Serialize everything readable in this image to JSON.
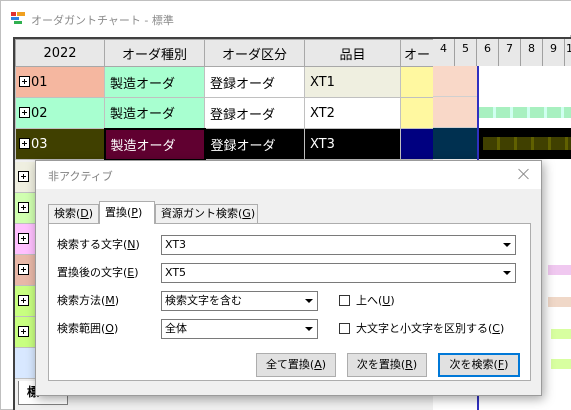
{
  "window": {
    "title": "オーダガントチャート - 標準"
  },
  "grid": {
    "headers": [
      "2022",
      "オーダ種別",
      "オーダ区分",
      "品目",
      "オー"
    ],
    "rows": [
      {
        "id": "01",
        "type": "製造オーダ",
        "category": "登録オーダ",
        "item": "XT1"
      },
      {
        "id": "02",
        "type": "製造オーダ",
        "category": "登録オーダ",
        "item": "XT2"
      },
      {
        "id": "03",
        "type": "製造オーダ",
        "category": "登録オーダ",
        "item": "XT3"
      }
    ],
    "row_colors": [
      "#f5b7a0",
      "#a8ffd0",
      "#8080ff",
      "#d0ffb0",
      "#ffc0ff",
      "#e8b8a8",
      "#c8ff80",
      "#c8ff80"
    ],
    "selected_row_color": "#600030"
  },
  "gantt": {
    "day_headers": [
      "4",
      "5",
      "6",
      "7",
      "8",
      "9",
      "1"
    ]
  },
  "dialog": {
    "title": "非アクティブ",
    "tabs": [
      {
        "label": "検索(",
        "key": "D",
        "end": ")"
      },
      {
        "label": "置換(",
        "key": "P",
        "end": ")"
      },
      {
        "label": "資源ガント検索(",
        "key": "G",
        "end": ")"
      }
    ],
    "search_label": {
      "pre": "検索する文字(",
      "key": "N",
      "end": ")"
    },
    "search_value": "XT3",
    "replace_label": {
      "pre": "置換後の文字(",
      "key": "E",
      "end": ")"
    },
    "replace_value": "XT5",
    "method_label": {
      "pre": "検索方法(",
      "key": "M",
      "end": ")"
    },
    "method_value": "検索文字を含む",
    "range_label": {
      "pre": "検索範囲(",
      "key": "O",
      "end": ")"
    },
    "range_value": "全体",
    "up_label": {
      "pre": "上へ(",
      "key": "U",
      "end": ")"
    },
    "case_label": {
      "pre": "大文字と小文字を区別する(",
      "key": "C",
      "end": ")"
    },
    "buttons": {
      "replace_all": {
        "pre": "全て置換(",
        "key": "A",
        "end": ")"
      },
      "replace_next": {
        "pre": "次を置換(",
        "key": "R",
        "end": ")"
      },
      "find_next": {
        "pre": "次を検索(",
        "key": "F",
        "end": ")"
      }
    }
  },
  "sheet_tab": {
    "label": "標"
  }
}
